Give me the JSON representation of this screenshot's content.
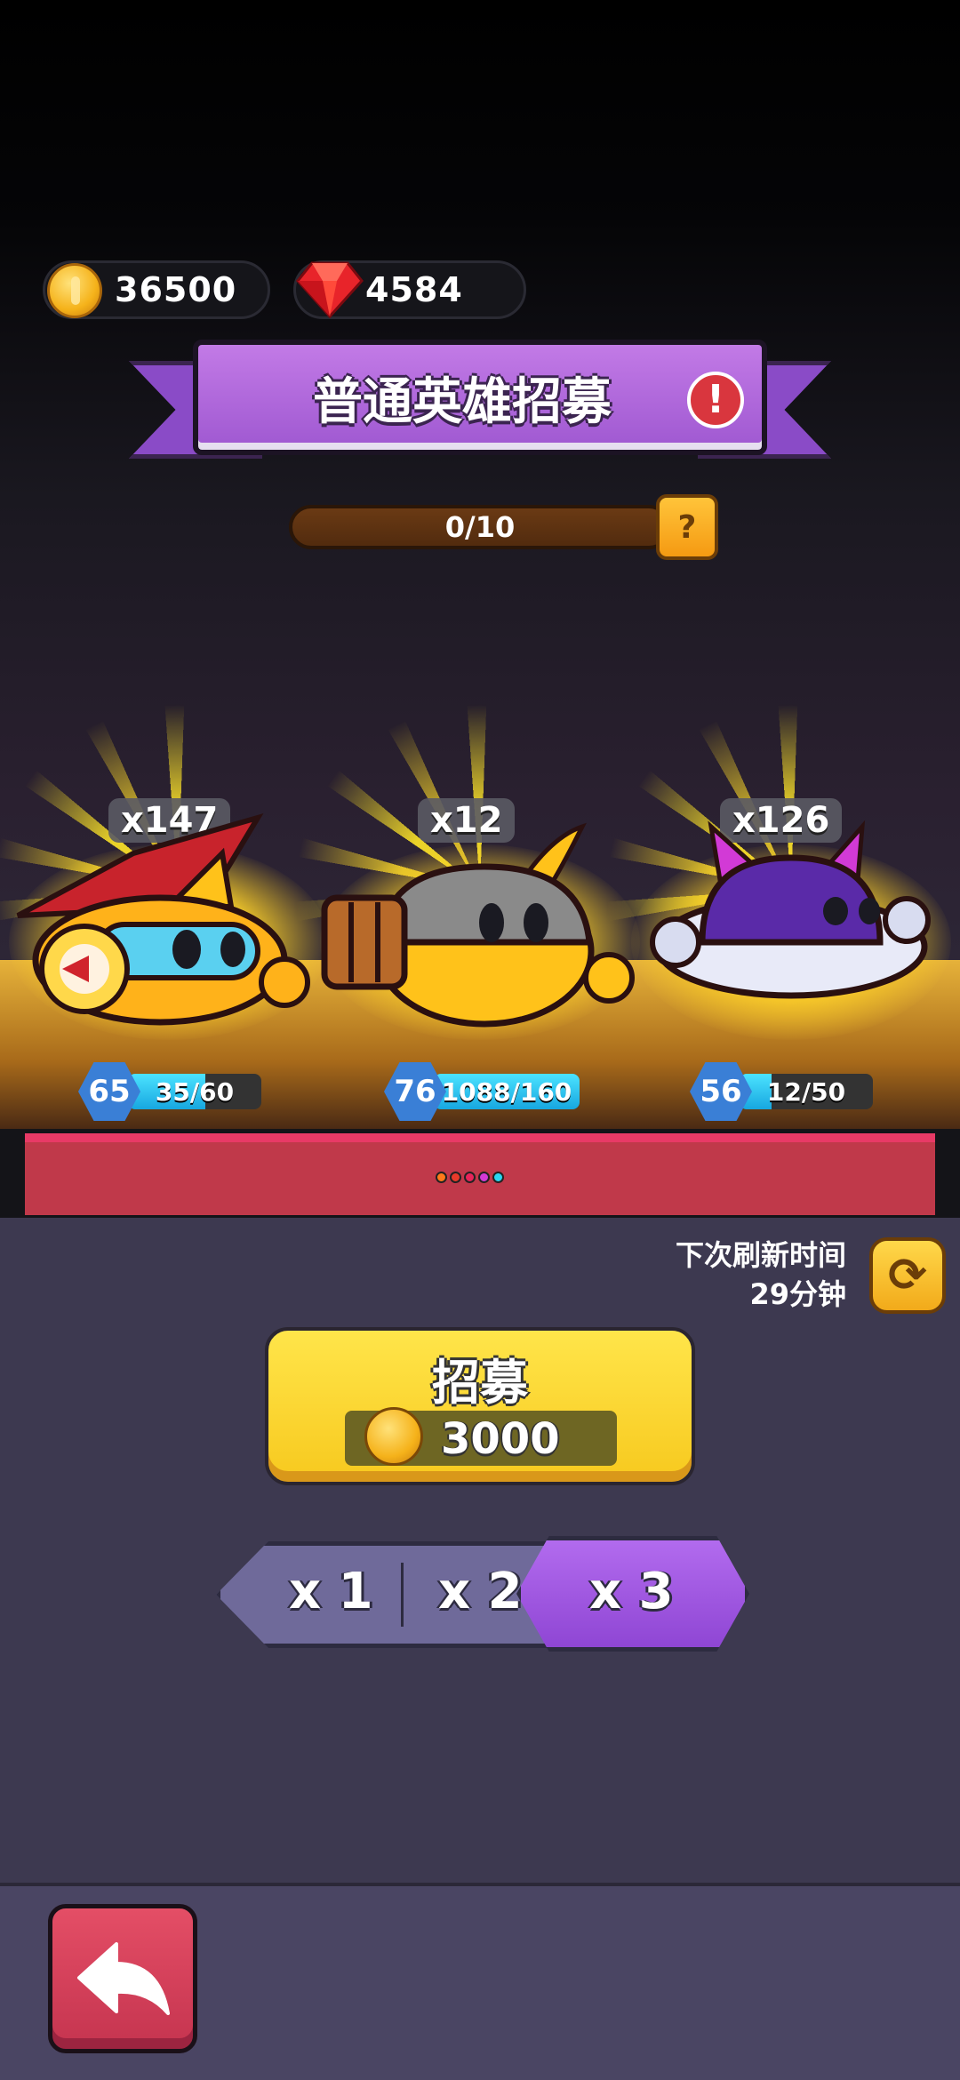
{
  "currency": {
    "gold": "36500",
    "gems": "4584",
    "coin_icon": "coin-icon",
    "gem_icon": "gem-icon"
  },
  "title": "普通英雄招募",
  "progress": {
    "text": "0/10",
    "current": 0,
    "max": 10
  },
  "help_label": "?",
  "heroes": [
    {
      "count": "x147",
      "level": "65",
      "shards": "35/60",
      "fill": 0.583
    },
    {
      "count": "x12",
      "level": "76",
      "shards": "1088/160",
      "fill": 1.0
    },
    {
      "count": "x126",
      "level": "56",
      "shards": "12/50",
      "fill": 0.24
    }
  ],
  "page_dots": [
    "#ff7a1a",
    "#e83a2a",
    "#e8245a",
    "#d43ad6",
    "#2ad6f0"
  ],
  "refresh": {
    "label": "下次刷新时间",
    "time": "29分钟"
  },
  "recruit": {
    "label": "招募",
    "cost": "3000"
  },
  "multiplier": {
    "options": [
      "x 1",
      "x 2",
      "x 3"
    ],
    "selected": "x 3"
  },
  "colors": {
    "accent_purple": "#9f58d1",
    "gold": "#f7c91e",
    "back_red": "#c5344f"
  }
}
